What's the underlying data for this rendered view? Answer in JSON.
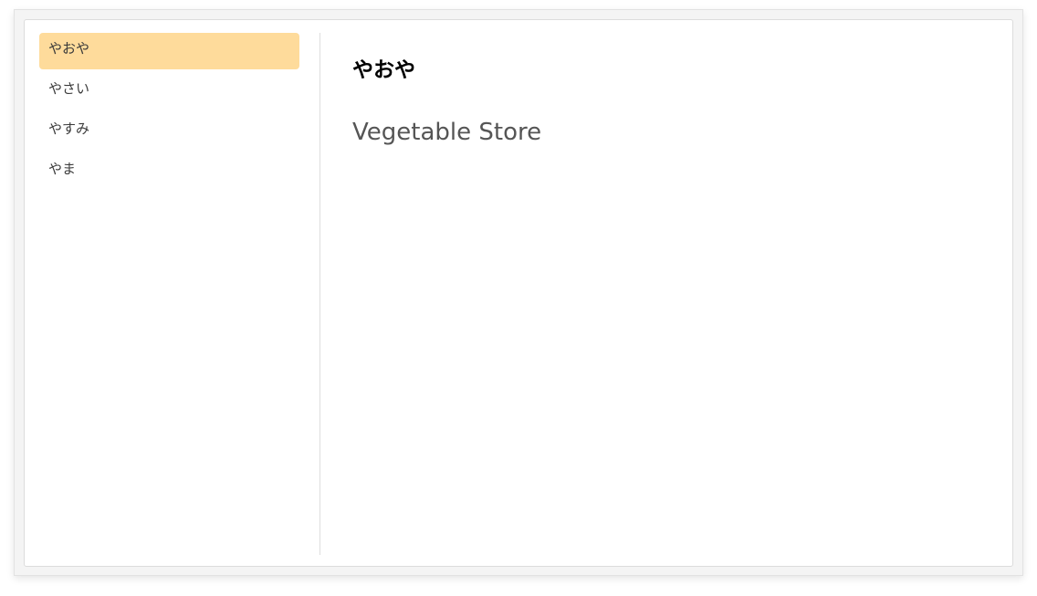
{
  "sidebar": {
    "items": [
      {
        "label": "やおや",
        "active": true
      },
      {
        "label": "やさい",
        "active": false
      },
      {
        "label": "やすみ",
        "active": false
      },
      {
        "label": "やま",
        "active": false
      }
    ]
  },
  "main": {
    "title": "やおや",
    "subtitle": "Vegetable Store"
  },
  "colors": {
    "active_item_bg": "#fedb9b",
    "divider": "#dddddd"
  }
}
